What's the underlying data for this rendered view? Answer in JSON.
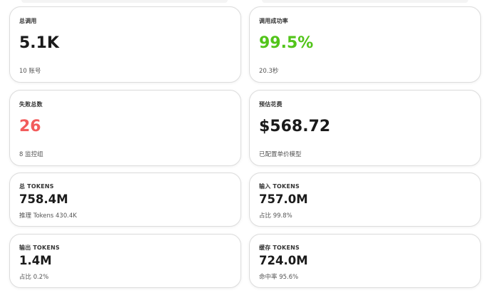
{
  "cards": [
    {
      "label": "总调用",
      "value": "5.1K",
      "sub": "10 账号"
    },
    {
      "label": "调用成功率",
      "value": "99.5%",
      "sub": "20.3秒",
      "value_color": "#52c41a"
    },
    {
      "label": "失败总数",
      "value": "26",
      "sub": "8 监控组",
      "value_color": "#f25c5c"
    },
    {
      "label": "预估花费",
      "value": "$568.72",
      "sub": "已配置单价模型"
    },
    {
      "label": "总 TOKENS",
      "value": "758.4M",
      "sub": "推理 Tokens 430.4K"
    },
    {
      "label": "输入 TOKENS",
      "value": "757.0M",
      "sub": "占比 99.8%"
    },
    {
      "label": "输出 TOKENS",
      "value": "1.4M",
      "sub": "占比 0.2%"
    },
    {
      "label": "缓存 TOKENS",
      "value": "724.0M",
      "sub": "命中率 95.6%"
    }
  ]
}
